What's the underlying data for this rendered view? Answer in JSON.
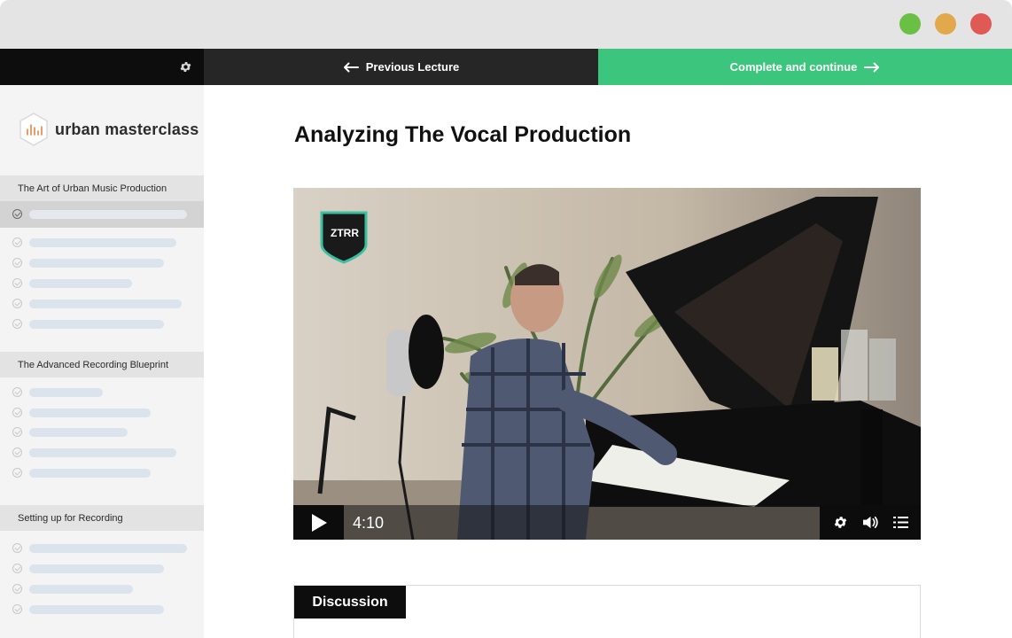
{
  "nav": {
    "prev_label": "Previous Lecture",
    "next_label": "Complete and continue",
    "accent": "#3cc57c"
  },
  "brand": {
    "name": "urban masterclass"
  },
  "sidebar": {
    "sections": [
      {
        "title": "The Art of Urban Music Production"
      },
      {
        "title": "The Advanced Recording Blueprint"
      },
      {
        "title": "Setting up for Recording"
      }
    ]
  },
  "lecture": {
    "title": "Analyzing The Vocal Production"
  },
  "video": {
    "badge": "ZTRR",
    "time": "4:10"
  },
  "discussion": {
    "tab_label": "Discussion"
  }
}
